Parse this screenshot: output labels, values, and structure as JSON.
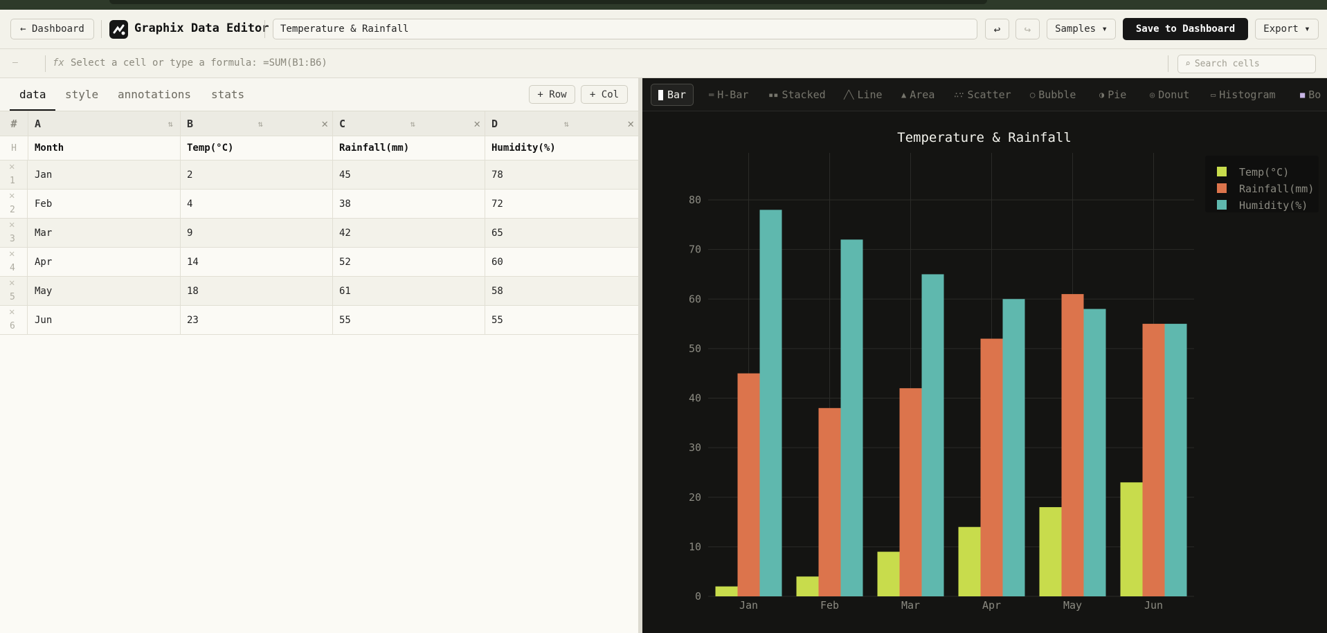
{
  "header": {
    "back_label": "← Dashboard",
    "app_title": "Graphix Data Editor",
    "doc_title": "Temperature & Rainfall",
    "undo_icon": "↩",
    "redo_icon": "↪",
    "samples_label": "Samples ▾",
    "save_label": "Save to Dashboard",
    "export_label": "Export ▾"
  },
  "formula_bar": {
    "cell_ref": "—",
    "fx": "fx",
    "placeholder": "Select a cell or type a formula: =SUM(B1:B6)",
    "search_placeholder": "Search cells",
    "search_icon": "⌕"
  },
  "tabs": [
    {
      "label": "data",
      "active": true
    },
    {
      "label": "style",
      "active": false
    },
    {
      "label": "annotations",
      "active": false
    },
    {
      "label": "stats",
      "active": false
    }
  ],
  "add_row_label": "+ Row",
  "add_col_label": "+ Col",
  "sheet": {
    "corner": "#",
    "header_row_label": "H",
    "columns": [
      "A",
      "B",
      "C",
      "D"
    ],
    "sort_icon": "⇅",
    "delete_icon": "✕",
    "headers": [
      "Month",
      "Temp(°C)",
      "Rainfall(mm)",
      "Humidity(%)"
    ],
    "rows": [
      {
        "num": "1",
        "cells": [
          "Jan",
          "2",
          "45",
          "78"
        ]
      },
      {
        "num": "2",
        "cells": [
          "Feb",
          "4",
          "38",
          "72"
        ]
      },
      {
        "num": "3",
        "cells": [
          "Mar",
          "9",
          "42",
          "65"
        ]
      },
      {
        "num": "4",
        "cells": [
          "Apr",
          "14",
          "52",
          "60"
        ]
      },
      {
        "num": "5",
        "cells": [
          "May",
          "18",
          "61",
          "58"
        ]
      },
      {
        "num": "6",
        "cells": [
          "Jun",
          "23",
          "55",
          "55"
        ]
      }
    ]
  },
  "chart_types": [
    {
      "label": "Bar",
      "icon": "",
      "active": true
    },
    {
      "label": "H-Bar",
      "icon": "═",
      "active": false
    },
    {
      "label": "Stacked",
      "icon": "▪▪",
      "active": false
    },
    {
      "label": "Line",
      "icon": "╱╲",
      "active": false
    },
    {
      "label": "Area",
      "icon": "▲",
      "active": false
    },
    {
      "label": "Scatter",
      "icon": "∴∵",
      "active": false
    },
    {
      "label": "Bubble",
      "icon": "◯",
      "active": false
    },
    {
      "label": "Pie",
      "icon": "◑",
      "active": false
    },
    {
      "label": "Donut",
      "icon": "◎",
      "active": false
    },
    {
      "label": "Histogram",
      "icon": "▭",
      "active": false
    },
    {
      "label": "Bo",
      "icon": "■",
      "active": false
    }
  ],
  "chart_data": {
    "type": "bar",
    "title": "Temperature & Rainfall",
    "categories": [
      "Jan",
      "Feb",
      "Mar",
      "Apr",
      "May",
      "Jun"
    ],
    "series": [
      {
        "name": "Temp(°C)",
        "values": [
          2,
          4,
          9,
          14,
          18,
          23
        ],
        "color": "#c8dc4c"
      },
      {
        "name": "Rainfall(mm)",
        "values": [
          45,
          38,
          42,
          52,
          61,
          55
        ],
        "color": "#dc744c"
      },
      {
        "name": "Humidity(%)",
        "values": [
          78,
          72,
          65,
          60,
          58,
          55
        ],
        "color": "#5fb8ae"
      }
    ],
    "ylim": [
      0,
      80
    ],
    "yticks": [
      0,
      10,
      20,
      30,
      40,
      50,
      60,
      70,
      80
    ],
    "grid": true,
    "legend": "top-right"
  }
}
